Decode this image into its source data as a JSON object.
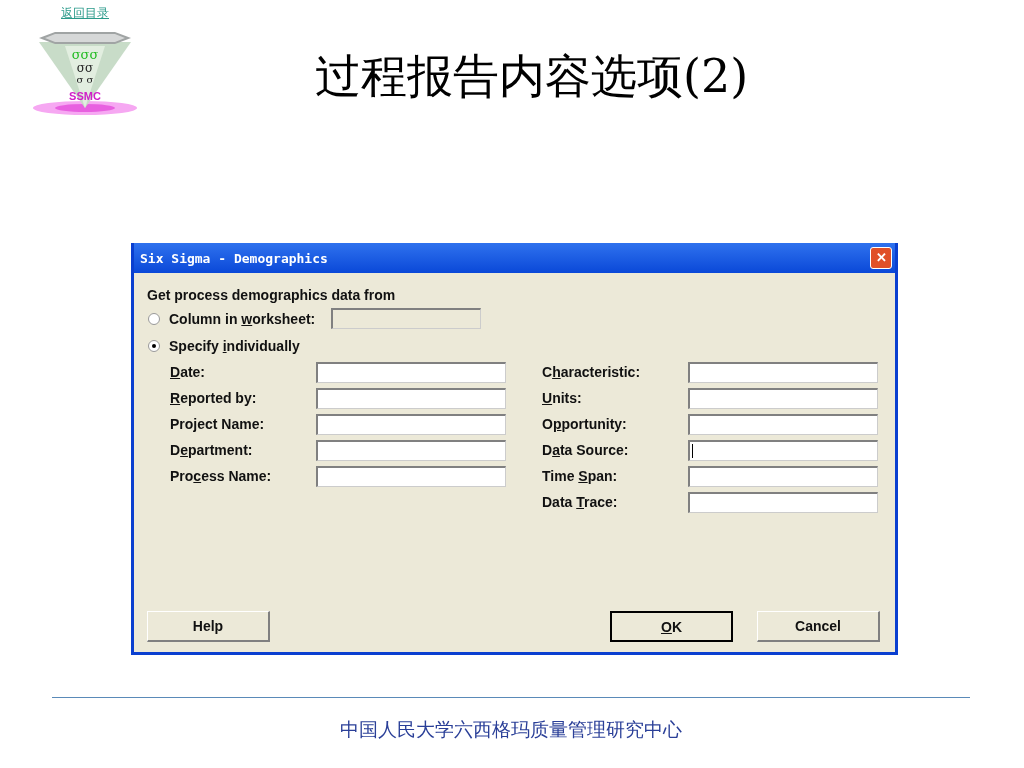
{
  "back_link": "返回目录",
  "logo": {
    "sigma_rows": [
      "σσσ",
      "σσ",
      "σ σ"
    ],
    "name": "SSMC"
  },
  "slide_title": "过程报告内容选项(2)",
  "dialog": {
    "title": "Six Sigma - Demographics",
    "close": "✕",
    "prompt": "Get process demographics data from",
    "sources": [
      {
        "label": {
          "before": "Column in ",
          "key": "w",
          "after": "orksheet:"
        },
        "selected": false,
        "kind": "field",
        "disabled": true
      },
      {
        "label": {
          "before": "Specify ",
          "key": "i",
          "after": "ndividually"
        },
        "selected": true,
        "kind": "plain"
      }
    ],
    "left_fields": [
      {
        "label": {
          "key": "D",
          "after": "ate:"
        },
        "focused": false
      },
      {
        "label": {
          "key": "R",
          "after": "eported by:"
        },
        "focused": false
      },
      {
        "label": {
          "before": "Project Name:"
        },
        "focused": false
      },
      {
        "label": {
          "before": "D",
          "key": "e",
          "after": "partment:"
        },
        "focused": false
      },
      {
        "label": {
          "before": "Pro",
          "key": "c",
          "after": "ess Name:"
        },
        "focused": false
      }
    ],
    "right_fields": [
      {
        "label": {
          "before": "C",
          "key": "h",
          "after": "aracteristic:"
        },
        "focused": false
      },
      {
        "label": {
          "key": "U",
          "after": "nits:"
        },
        "focused": false
      },
      {
        "label": {
          "before": "O",
          "key": "p",
          "after": "portunity:"
        },
        "focused": false
      },
      {
        "label": {
          "before": "D",
          "key": "a",
          "after": "ta Source:"
        },
        "focused": true
      },
      {
        "label": {
          "before": "Time ",
          "key": "S",
          "after": "pan:"
        },
        "focused": false
      },
      {
        "label": {
          "before": "Data ",
          "key": "T",
          "after": "race:"
        },
        "focused": false
      }
    ],
    "buttons": [
      {
        "label": {
          "before": "Help"
        },
        "default": false
      },
      {
        "label": {
          "key": "O",
          "after": "K"
        },
        "default": true
      },
      {
        "label": {
          "before": "Cancel"
        },
        "default": false
      }
    ]
  },
  "footer": "中国人民大学六西格玛质量管理研究中心"
}
